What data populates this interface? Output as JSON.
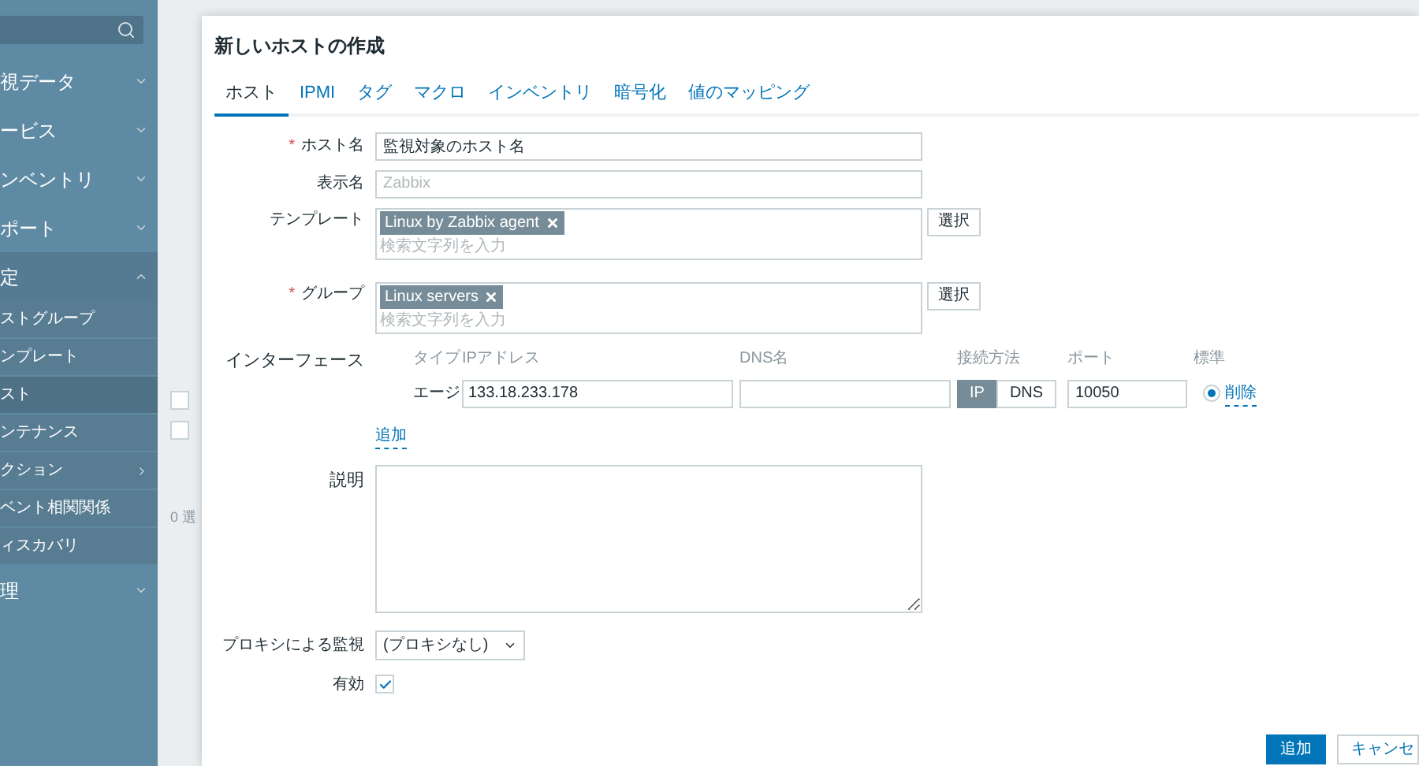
{
  "sidebar": {
    "items": [
      {
        "label": "視データ",
        "expanded": false
      },
      {
        "label": "ービス",
        "expanded": false
      },
      {
        "label": "ンベントリ",
        "expanded": false
      },
      {
        "label": "ポート",
        "expanded": false
      },
      {
        "label": "定",
        "expanded": true,
        "children": [
          {
            "label": "ストグループ",
            "selected": false,
            "submenu": false
          },
          {
            "label": "ンプレート",
            "selected": false,
            "submenu": false
          },
          {
            "label": "スト",
            "selected": true,
            "submenu": false
          },
          {
            "label": "ンテナンス",
            "selected": false,
            "submenu": false
          },
          {
            "label": "クション",
            "selected": false,
            "submenu": true
          },
          {
            "label": "ベント相関関係",
            "selected": false,
            "submenu": false
          },
          {
            "label": "ィスカバリ",
            "selected": false,
            "submenu": false
          }
        ]
      },
      {
        "label": "理",
        "expanded": false
      }
    ]
  },
  "background_page": {
    "rows": [
      {
        "checked": false
      },
      {
        "checked": false
      }
    ],
    "selection_text": "0 選"
  },
  "dialog": {
    "title": "新しいホストの作成",
    "tabs": [
      {
        "label": "ホスト",
        "selected": true
      },
      {
        "label": "IPMI",
        "selected": false
      },
      {
        "label": "タグ",
        "selected": false
      },
      {
        "label": "マクロ",
        "selected": false
      },
      {
        "label": "インベントリ",
        "selected": false
      },
      {
        "label": "暗号化",
        "selected": false
      },
      {
        "label": "値のマッピング",
        "selected": false
      }
    ],
    "host_name": {
      "label": "ホスト名",
      "required_mark": "*",
      "value": "監視対象のホスト名"
    },
    "visible_name": {
      "label": "表示名",
      "placeholder": "Zabbix"
    },
    "templates": {
      "label": "テンプレート",
      "tags": [
        "Linux by Zabbix agent"
      ],
      "placeholder": "検索文字列を入力",
      "button": "選択"
    },
    "groups": {
      "label": "グループ",
      "required_mark": "*",
      "tags": [
        "Linux servers"
      ],
      "placeholder": "検索文字列を入力",
      "button": "選択"
    },
    "interfaces": {
      "label": "インターフェース",
      "headers": [
        "タイプ",
        "IPアドレス",
        "DNS名",
        "接続方法",
        "ポート",
        "標準"
      ],
      "rows": [
        {
          "type": "エージ",
          "ip": "133.18.233.178",
          "connect": [
            {
              "label": "IP",
              "selected": true
            },
            {
              "label": "DNS",
              "selected": false
            }
          ],
          "port": "10050",
          "default": true,
          "remove": "削除"
        }
      ],
      "add_link": "追加"
    },
    "description": {
      "label": "説明"
    },
    "proxy": {
      "label": "プロキシによる監視",
      "value": "(プロキシなし)"
    },
    "enabled": {
      "label": "有効",
      "checked": true
    },
    "buttons": [
      {
        "label": "追加",
        "kind": "primary"
      },
      {
        "label": "キャンセ",
        "kind": "secondary"
      }
    ]
  }
}
